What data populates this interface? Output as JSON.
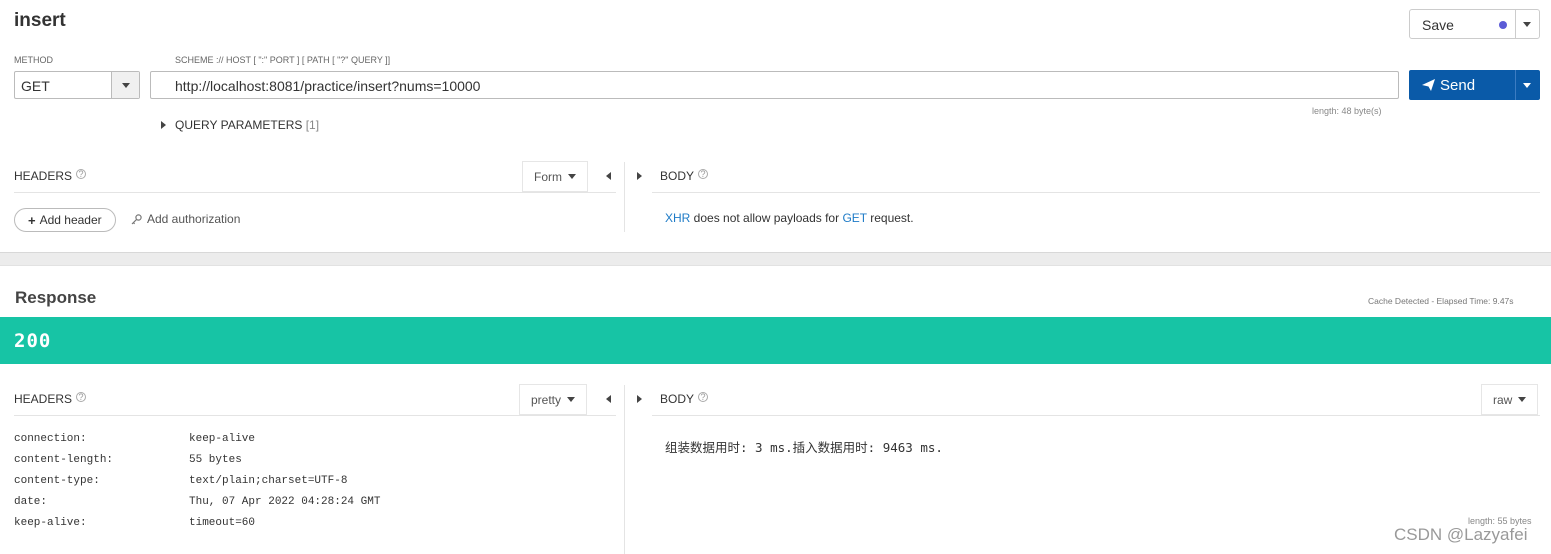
{
  "request": {
    "title": "insert",
    "save_label": "Save",
    "method_label": "METHOD",
    "method_value": "GET",
    "url_label": "SCHEME :// HOST [ \":\" PORT ] [ PATH [ \"?\" QUERY ]]",
    "url_value": "http://localhost:8081/practice/insert?nums=10000",
    "url_length": "length: 48 byte(s)",
    "send_label": "Send",
    "query_params_label": "QUERY PARAMETERS",
    "query_params_count": "[1]",
    "headers_label": "HEADERS",
    "headers_mode": "Form",
    "add_header_label": "Add header",
    "add_auth_label": "Add authorization",
    "body_label": "BODY",
    "body_msg": {
      "link1": "XHR",
      "text1": " does not allow payloads for ",
      "link2": "GET",
      "text2": " request."
    }
  },
  "response": {
    "title": "Response",
    "meta": "Cache Detected - Elapsed Time: 9.47s",
    "status_code": "200",
    "headers_label": "HEADERS",
    "headers_mode": "pretty",
    "body_label": "BODY",
    "body_mode": "raw",
    "headers": [
      {
        "key": "connection:",
        "value": "keep-alive"
      },
      {
        "key": "content-length:",
        "value": "55 bytes"
      },
      {
        "key": "content-type:",
        "value": "text/plain;charset=UTF-8"
      },
      {
        "key": "date:",
        "value": "Thu, 07 Apr 2022 04:28:24 GMT"
      },
      {
        "key": "keep-alive:",
        "value": "timeout=60"
      }
    ],
    "body_text": "组装数据用时: 3 ms.插入数据用时: 9463 ms.",
    "body_length": "length: 55 bytes"
  },
  "watermark": "CSDN @Lazyafei",
  "colors": {
    "accent": "#0a5aa8",
    "status_ok": "#17c4a5",
    "link": "#1e7bc7"
  }
}
